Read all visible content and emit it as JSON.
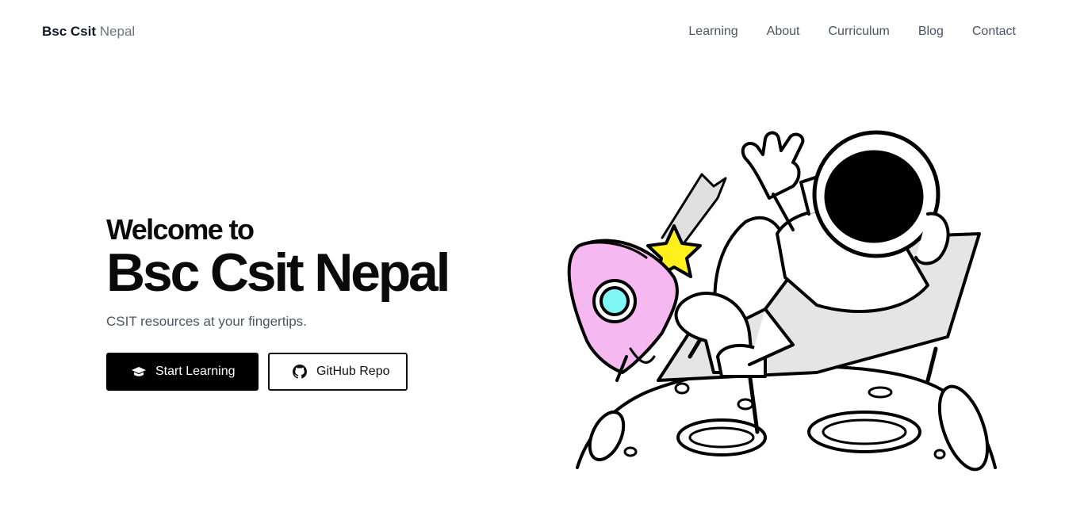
{
  "brand": {
    "name_bold": "Bsc Csit",
    "name_light": "Nepal"
  },
  "nav": {
    "items": [
      {
        "label": "Learning"
      },
      {
        "label": "About"
      },
      {
        "label": "Curriculum"
      },
      {
        "label": "Blog"
      },
      {
        "label": "Contact"
      }
    ]
  },
  "hero": {
    "welcome": "Welcome to",
    "title": "Bsc Csit Nepal",
    "tagline": "CSIT resources at your fingertips.",
    "primary_button": {
      "label": "Start Learning",
      "icon": "book-icon"
    },
    "secondary_button": {
      "label": "GitHub Repo",
      "icon": "github-icon"
    }
  },
  "illustration": {
    "subject": "astronaut-relaxing-on-moon-icon"
  },
  "colors": {
    "text_primary": "#0a0a0a",
    "text_muted": "#4b5563",
    "button_primary_bg": "#000000",
    "rocket_pink": "#f5b8f0",
    "rocket_window": "#7ff7f7",
    "star_yellow": "#ffef1a"
  }
}
